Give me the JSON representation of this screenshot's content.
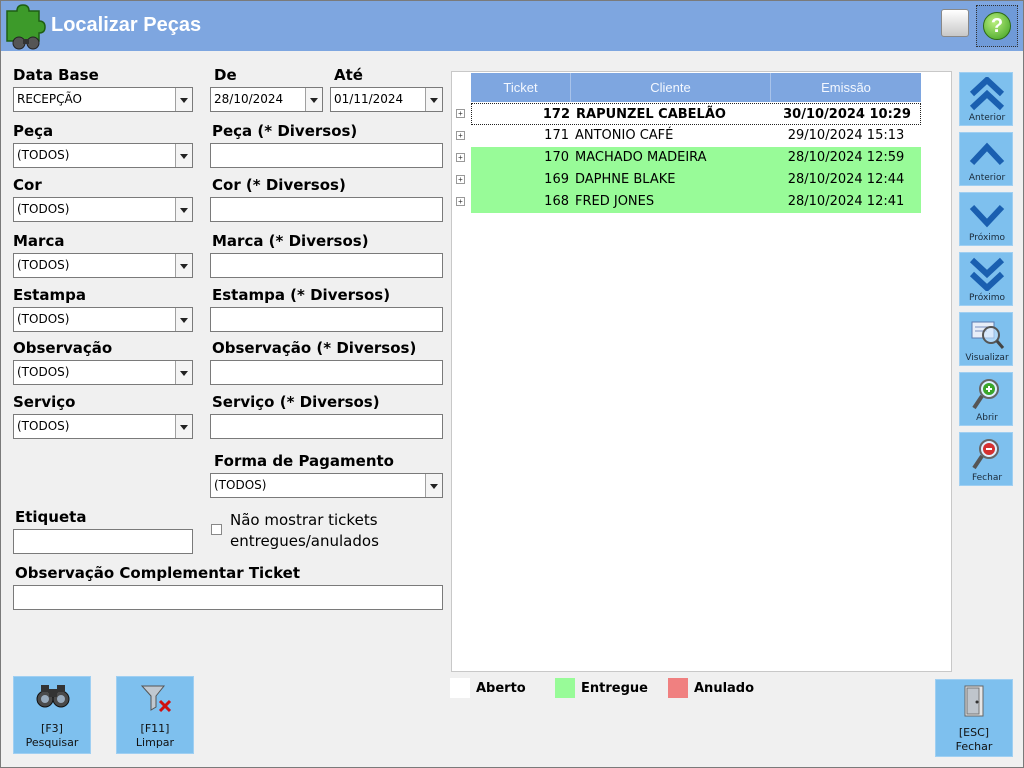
{
  "window": {
    "title": "Localizar Peças"
  },
  "titlebar": {
    "help_glyph": "?"
  },
  "filters": {
    "data_base": {
      "label": "Data Base",
      "value": "RECEPÇÃO"
    },
    "de": {
      "label": "De",
      "value": "28/10/2024"
    },
    "ate": {
      "label": "Até",
      "value": "01/11/2024"
    },
    "peca": {
      "label": "Peça",
      "value": "(TODOS)",
      "diversos_label": "Peça (* Diversos)"
    },
    "cor": {
      "label": "Cor",
      "value": "(TODOS)",
      "diversos_label": "Cor (* Diversos)"
    },
    "marca": {
      "label": "Marca",
      "value": "(TODOS)",
      "diversos_label": "Marca (* Diversos)"
    },
    "estampa": {
      "label": "Estampa",
      "value": "(TODOS)",
      "diversos_label": "Estampa (* Diversos)"
    },
    "observacao": {
      "label": "Observação",
      "value": "(TODOS)",
      "diversos_label": "Observação (* Diversos)"
    },
    "servico": {
      "label": "Serviço",
      "value": "(TODOS)",
      "diversos_label": "Serviço (* Diversos)"
    },
    "forma_pagamento": {
      "label": "Forma de Pagamento",
      "value": "(TODOS)"
    },
    "etiqueta": {
      "label": "Etiqueta",
      "value": ""
    },
    "nao_mostrar": {
      "label": "Não mostrar tickets entregues/anulados",
      "checked": false
    },
    "obs_complementar": {
      "label": "Observação Complementar Ticket",
      "value": ""
    }
  },
  "grid": {
    "columns": [
      "Ticket",
      "Cliente",
      "Emissão"
    ],
    "rows": [
      {
        "ticket": "172",
        "cliente": "RAPUNZEL CABELÃO",
        "emissao": "30/10/2024 10:29",
        "status": "aberto"
      },
      {
        "ticket": "171",
        "cliente": "ANTONIO CAFÉ",
        "emissao": "29/10/2024 15:13",
        "status": "aberto"
      },
      {
        "ticket": "170",
        "cliente": "MACHADO MADEIRA",
        "emissao": "28/10/2024 12:59",
        "status": "entregue"
      },
      {
        "ticket": "169",
        "cliente": "DAPHNE BLAKE",
        "emissao": "28/10/2024 12:44",
        "status": "entregue"
      },
      {
        "ticket": "168",
        "cliente": "FRED JONES",
        "emissao": "28/10/2024 12:41",
        "status": "entregue"
      }
    ]
  },
  "legend": {
    "aberto": {
      "label": "Aberto",
      "color": "#ffffff"
    },
    "entregue": {
      "label": "Entregue",
      "color": "#98fb98"
    },
    "anulado": {
      "label": "Anulado",
      "color": "#f08080"
    }
  },
  "nav": {
    "first": "Anterior",
    "prev": "Anterior",
    "next": "Próximo",
    "last": "Próximo",
    "visualizar": "Visualizar",
    "abrir": "Abrir",
    "fechar": "Fechar"
  },
  "buttons": {
    "pesquisar": {
      "key": "[F3]",
      "label": "Pesquisar"
    },
    "limpar": {
      "key": "[F11]",
      "label": "Limpar"
    },
    "fechar": {
      "key": "[ESC]",
      "label": "Fechar"
    }
  },
  "colors": {
    "titlebar": "#7ea6e0",
    "button": "#7ec0ee",
    "entregue_row": "#98fb98"
  }
}
